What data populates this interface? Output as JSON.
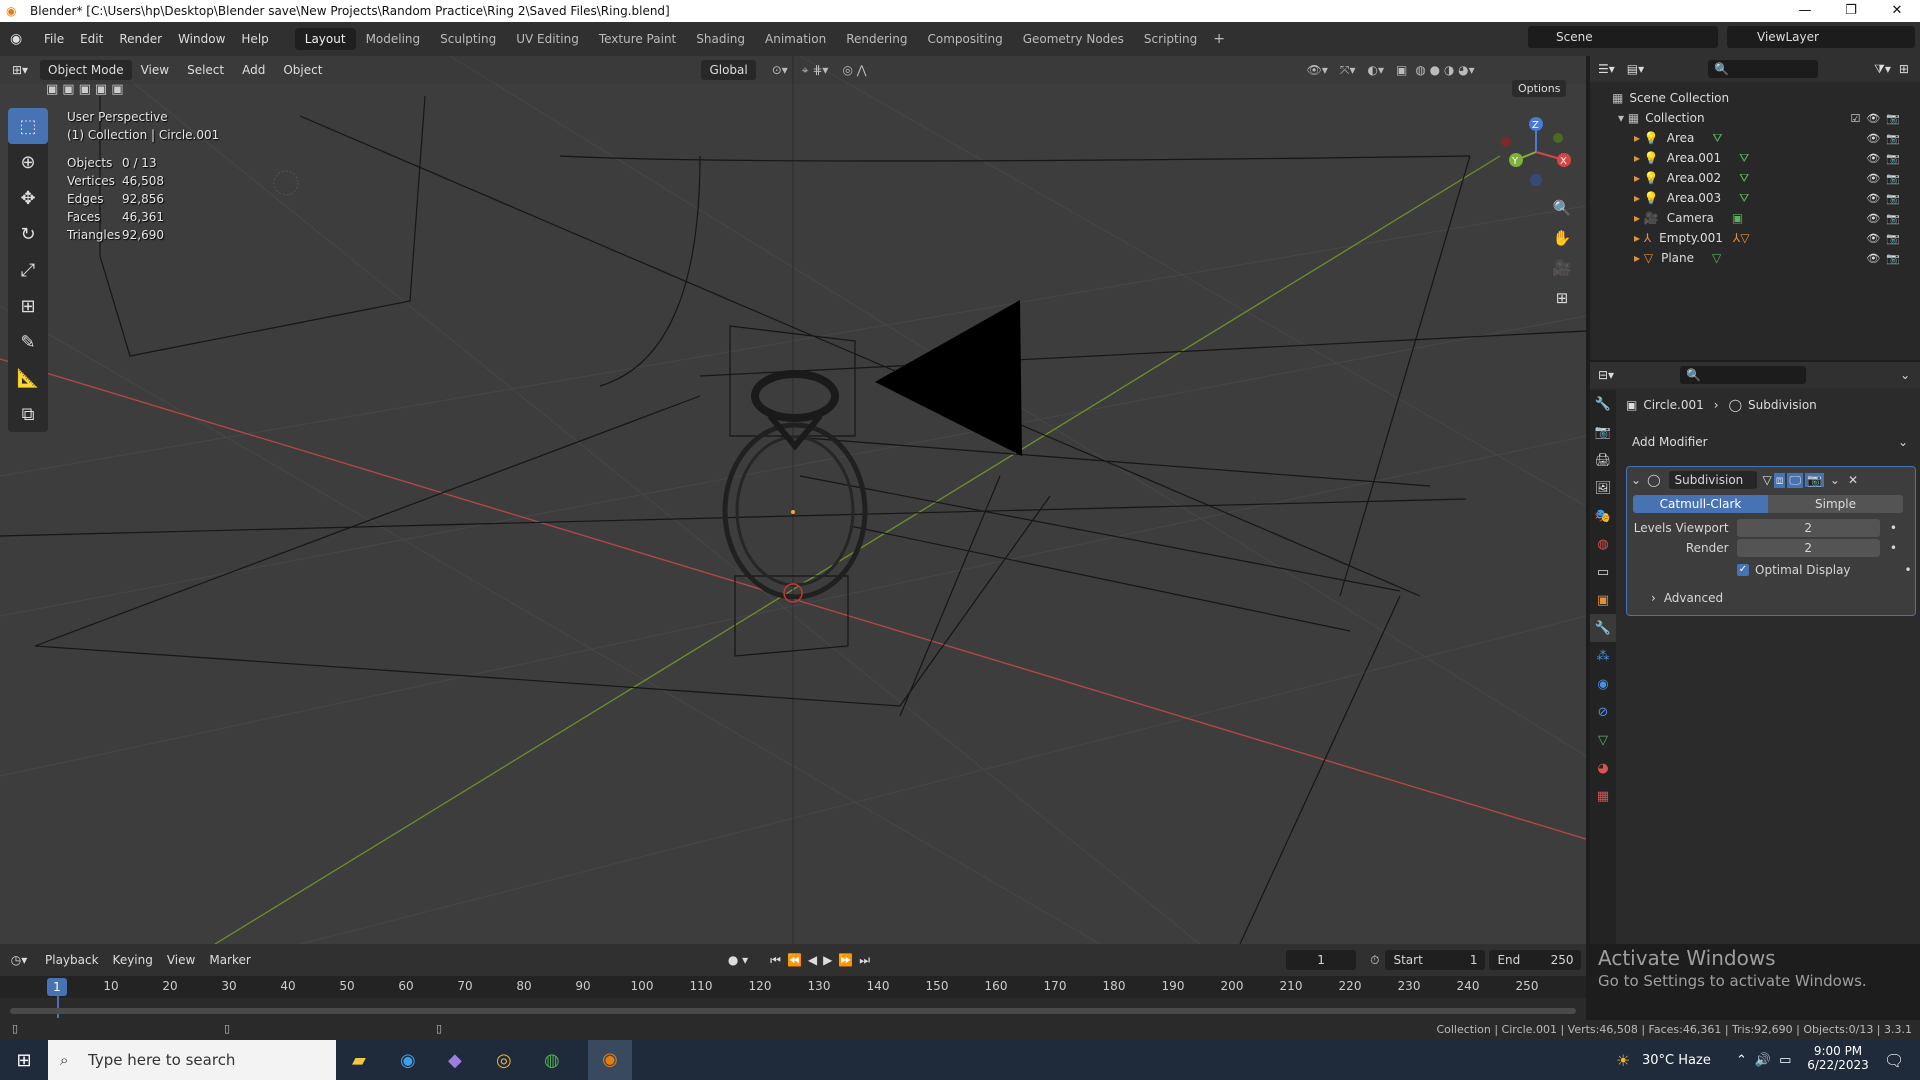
{
  "window": {
    "title": "Blender* [C:\\Users\\hp\\Desktop\\Blender save\\New Projects\\Random Practice\\Ring 2\\Saved Files\\Ring.blend]"
  },
  "menu": [
    "File",
    "Edit",
    "Render",
    "Window",
    "Help"
  ],
  "workspaces": [
    "Layout",
    "Modeling",
    "Sculpting",
    "UV Editing",
    "Texture Paint",
    "Shading",
    "Animation",
    "Rendering",
    "Compositing",
    "Geometry Nodes",
    "Scripting"
  ],
  "active_workspace": "Layout",
  "scene": {
    "scene_name": "Scene",
    "view_layer": "ViewLayer"
  },
  "viewport": {
    "mode": "Object Mode",
    "menus": [
      "View",
      "Select",
      "Add",
      "Object"
    ],
    "orientation": "Global",
    "options_label": "Options",
    "overlay_line1": "User Perspective",
    "overlay_line2": "(1) Collection | Circle.001",
    "stats": [
      {
        "k": "Objects",
        "v": "0 / 13"
      },
      {
        "k": "Vertices",
        "v": "46,508"
      },
      {
        "k": "Edges",
        "v": "92,856"
      },
      {
        "k": "Faces",
        "v": "46,361"
      },
      {
        "k": "Triangles",
        "v": "92,690"
      }
    ],
    "gizmo": {
      "z": "Z",
      "x": "X",
      "y": "Y"
    }
  },
  "outliner": {
    "root": "Scene Collection",
    "collection": "Collection",
    "items": [
      "Area",
      "Area.001",
      "Area.002",
      "Area.003",
      "Camera",
      "Empty.001",
      "Plane"
    ]
  },
  "properties": {
    "breadcrumb_object": "Circle.001",
    "breadcrumb_modifier": "Subdivision",
    "add_modifier": "Add Modifier",
    "modifier_name": "Subdivision",
    "type_catmull": "Catmull-Clark",
    "type_simple": "Simple",
    "levels_viewport_label": "Levels Viewport",
    "levels_viewport_value": "2",
    "render_label": "Render",
    "render_value": "2",
    "optimal_display": "Optimal Display",
    "advanced": "Advanced"
  },
  "timeline": {
    "menus": [
      "Playback",
      "Keying",
      "View",
      "Marker"
    ],
    "current_frame": "1",
    "start_label": "Start",
    "start_value": "1",
    "end_label": "End",
    "end_value": "250",
    "ticks": [
      "10",
      "20",
      "30",
      "40",
      "50",
      "60",
      "70",
      "80",
      "90",
      "100",
      "110",
      "120",
      "130",
      "140",
      "150",
      "160",
      "170",
      "180",
      "190",
      "200",
      "210",
      "220",
      "230",
      "240",
      "250"
    ]
  },
  "statusbar": {
    "text": "Collection | Circle.001 | Verts:46,508 | Faces:46,361 | Tris:92,690 | Objects:0/13 | 3.3.1"
  },
  "watermark": {
    "line1": "Activate Windows",
    "line2": "Go to Settings to activate Windows."
  },
  "taskbar": {
    "search_placeholder": "Type here to search",
    "weather": "30°C  Haze",
    "time": "9:00 PM",
    "date": "6/22/2023"
  }
}
